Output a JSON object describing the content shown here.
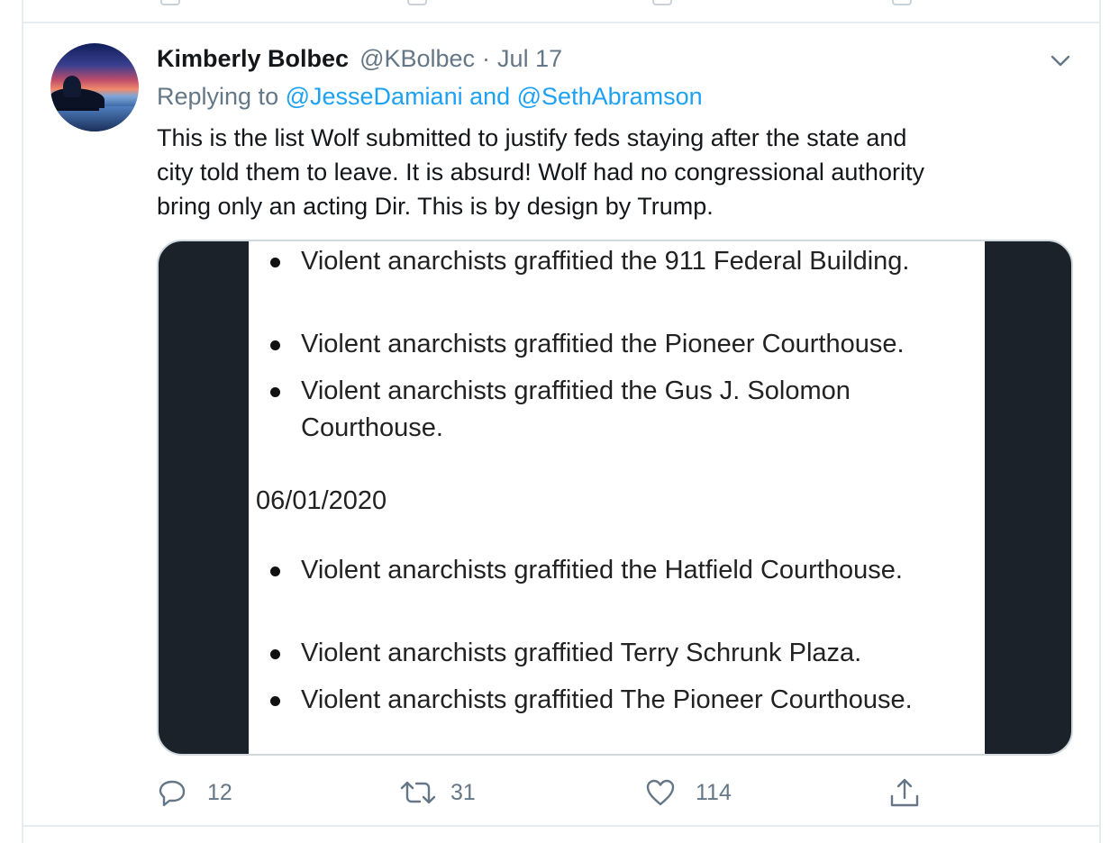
{
  "tweet": {
    "author_name": "Kimberly Bolbec",
    "author_handle": "@KBolbec",
    "separator": "·",
    "date": "Jul 17",
    "replying_prefix": "Replying to",
    "replying_to": "@JesseDamiani and @SethAbramson",
    "text": "This is the list Wolf submitted to justify feds staying after the state and\ncity told them to leave.  It is absurd!  Wolf had no congressional authority\nbring only an acting Dir.  This is by design by Trump.",
    "media_document": {
      "items_before": [
        "Violent anarchists graffitied the 911 Federal Building.",
        "Violent anarchists graffitied the Pioneer Courthouse.",
        "Violent anarchists graffitied the Gus J. Solomon Courthouse."
      ],
      "date_heading": "06/01/2020",
      "items_after": [
        "Violent anarchists graffitied the Hatfield Courthouse.",
        "Violent anarchists graffitied Terry Schrunk Plaza.",
        "Violent anarchists graffitied The Pioneer Courthouse."
      ]
    },
    "actions": {
      "reply_count": "12",
      "retweet_count": "31",
      "like_count": "114"
    }
  },
  "icons": [
    "chevron-down-icon",
    "reply-icon",
    "retweet-icon",
    "like-icon",
    "share-icon"
  ],
  "colors": {
    "link": "#1da1f2",
    "secondary_text": "#657786",
    "border": "#e6ecf0",
    "media_bg": "#1c2229"
  }
}
